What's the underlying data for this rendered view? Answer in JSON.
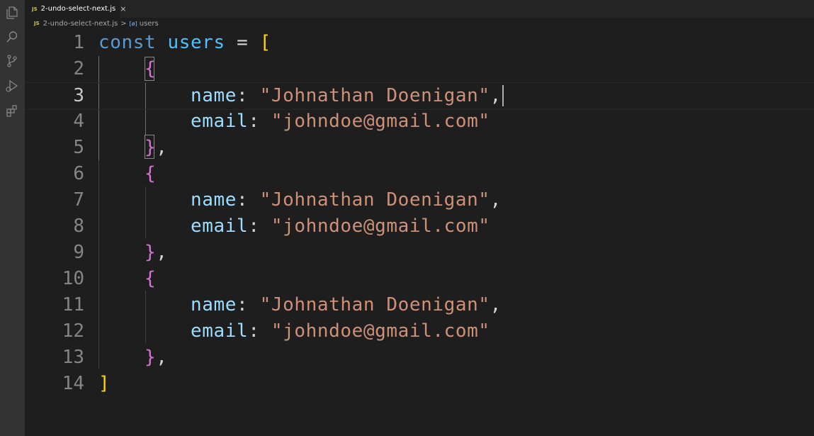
{
  "tab": {
    "badge": "JS",
    "label": "2-undo-select-next.js",
    "close": "×"
  },
  "breadcrumb": {
    "badge": "JS",
    "file": "2-undo-select-next.js",
    "separator": ">",
    "symbol_icon": "[ø]",
    "symbol": "users"
  },
  "activity_icons": [
    "explorer-icon",
    "search-icon",
    "source-control-icon",
    "run-debug-icon",
    "extensions-icon"
  ],
  "editor": {
    "current_line": 3,
    "lines": [
      {
        "num": "1",
        "a": "const",
        "b": " ",
        "c": "users",
        "d": " = ",
        "e": "["
      },
      {
        "num": "2",
        "indent": "    ",
        "brace": "{"
      },
      {
        "num": "3",
        "indent": "        ",
        "key": "name",
        "colon": ": ",
        "value": "\"Johnathan Doenigan\"",
        "tail": ","
      },
      {
        "num": "4",
        "indent": "        ",
        "key": "email",
        "colon": ": ",
        "value": "\"johndoe@gmail.com\"",
        "tail": ""
      },
      {
        "num": "5",
        "indent": "    ",
        "brace": "}",
        "tail": ","
      },
      {
        "num": "6",
        "indent": "    ",
        "brace": "{"
      },
      {
        "num": "7",
        "indent": "        ",
        "key": "name",
        "colon": ": ",
        "value": "\"Johnathan Doenigan\"",
        "tail": ","
      },
      {
        "num": "8",
        "indent": "        ",
        "key": "email",
        "colon": ": ",
        "value": "\"johndoe@gmail.com\"",
        "tail": ""
      },
      {
        "num": "9",
        "indent": "    ",
        "brace": "}",
        "tail": ","
      },
      {
        "num": "10",
        "indent": "    ",
        "brace": "{"
      },
      {
        "num": "11",
        "indent": "        ",
        "key": "name",
        "colon": ": ",
        "value": "\"Johnathan Doenigan\"",
        "tail": ","
      },
      {
        "num": "12",
        "indent": "        ",
        "key": "email",
        "colon": ": ",
        "value": "\"johndoe@gmail.com\"",
        "tail": ""
      },
      {
        "num": "13",
        "indent": "    ",
        "brace": "}",
        "tail": ","
      },
      {
        "num": "14",
        "close": "]"
      }
    ]
  },
  "colors": {
    "editor_bg": "#1e1e1e",
    "keyword": "#569cd6",
    "variable": "#4fc1ff",
    "property": "#9cdcfe",
    "string": "#ce9178",
    "bracket_level1": "#ffd700",
    "bracket_level2": "#da70d6"
  }
}
